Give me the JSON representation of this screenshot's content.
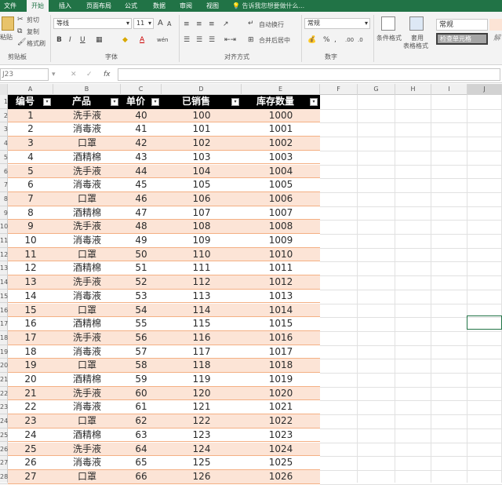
{
  "tabs": [
    "文件",
    "开始",
    "插入",
    "页面布局",
    "公式",
    "数据",
    "审阅",
    "视图"
  ],
  "active_tab": "开始",
  "tell_me": "告诉我您想要做什么...",
  "ribbon": {
    "clipboard": {
      "paste": "粘贴",
      "cut": "剪切",
      "copy": "复制",
      "format_painter": "格式刷",
      "group": "剪贴板"
    },
    "font": {
      "name": "等线",
      "size": "11",
      "grow": "A",
      "shrink": "A",
      "bold": "B",
      "italic": "I",
      "underline": "U",
      "wen": "wén",
      "group": "字体"
    },
    "alignment": {
      "wrap": "自动换行",
      "merge": "合并后居中",
      "group": "对齐方式"
    },
    "number": {
      "format": "常规",
      "group": "数字"
    },
    "styles": {
      "conditional": "条件格式",
      "table_format_1": "套用",
      "table_format_2": "表格格式",
      "normal": "常规",
      "check_cell": "检查单元格",
      "explain": "解"
    }
  },
  "formula_bar": {
    "name_box": "J23",
    "fx": "fx"
  },
  "columns": [
    "A",
    "B",
    "C",
    "D",
    "E",
    "F",
    "G",
    "H",
    "I",
    "J"
  ],
  "row_numbers": [
    "1",
    "2",
    "3",
    "4",
    "5",
    "6",
    "7",
    "8",
    "9",
    "10",
    "11",
    "12",
    "13",
    "14",
    "15",
    "16",
    "17",
    "18",
    "19",
    "20",
    "21",
    "22",
    "23",
    "24",
    "25",
    "26",
    "27",
    "28"
  ],
  "table": {
    "headers": [
      "编号",
      "产品",
      "单价",
      "已销售",
      "库存数量"
    ],
    "filter_icon": "▾",
    "rows": [
      [
        "1",
        "洗手液",
        "40",
        "100",
        "1000"
      ],
      [
        "2",
        "消毒液",
        "41",
        "101",
        "1001"
      ],
      [
        "3",
        "口罩",
        "42",
        "102",
        "1002"
      ],
      [
        "4",
        "酒精棉",
        "43",
        "103",
        "1003"
      ],
      [
        "5",
        "洗手液",
        "44",
        "104",
        "1004"
      ],
      [
        "6",
        "消毒液",
        "45",
        "105",
        "1005"
      ],
      [
        "7",
        "口罩",
        "46",
        "106",
        "1006"
      ],
      [
        "8",
        "酒精棉",
        "47",
        "107",
        "1007"
      ],
      [
        "9",
        "洗手液",
        "48",
        "108",
        "1008"
      ],
      [
        "10",
        "消毒液",
        "49",
        "109",
        "1009"
      ],
      [
        "11",
        "口罩",
        "50",
        "110",
        "1010"
      ],
      [
        "12",
        "酒精棉",
        "51",
        "111",
        "1011"
      ],
      [
        "13",
        "洗手液",
        "52",
        "112",
        "1012"
      ],
      [
        "14",
        "消毒液",
        "53",
        "113",
        "1013"
      ],
      [
        "15",
        "口罩",
        "54",
        "114",
        "1014"
      ],
      [
        "16",
        "酒精棉",
        "55",
        "115",
        "1015"
      ],
      [
        "17",
        "洗手液",
        "56",
        "116",
        "1016"
      ],
      [
        "18",
        "消毒液",
        "57",
        "117",
        "1017"
      ],
      [
        "19",
        "口罩",
        "58",
        "118",
        "1018"
      ],
      [
        "20",
        "酒精棉",
        "59",
        "119",
        "1019"
      ],
      [
        "21",
        "洗手液",
        "60",
        "120",
        "1020"
      ],
      [
        "22",
        "消毒液",
        "61",
        "121",
        "1021"
      ],
      [
        "23",
        "口罩",
        "62",
        "122",
        "1022"
      ],
      [
        "24",
        "酒精棉",
        "63",
        "123",
        "1023"
      ],
      [
        "25",
        "洗手液",
        "64",
        "124",
        "1024"
      ],
      [
        "26",
        "消毒液",
        "65",
        "125",
        "1025"
      ],
      [
        "27",
        "口罩",
        "66",
        "126",
        "1026"
      ]
    ]
  },
  "colors": {
    "accent": "#217346",
    "band": "#fce4d6",
    "header": "#000000"
  }
}
